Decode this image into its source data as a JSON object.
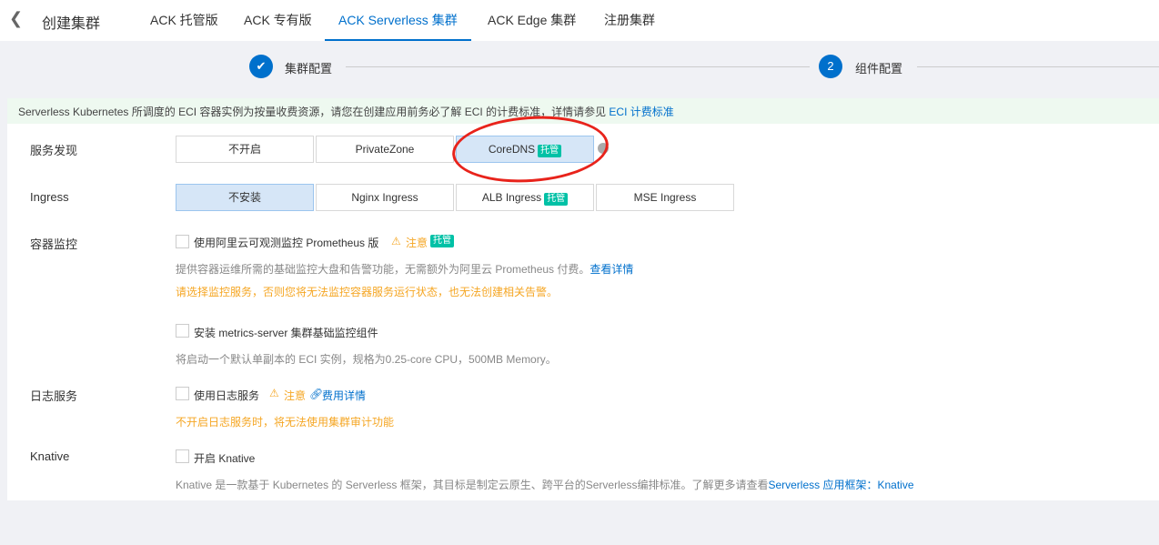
{
  "header": {
    "back_icon": "chevron-left-icon",
    "title": "创建集群",
    "tabs": [
      "ACK 托管版",
      "ACK 专有版",
      "ACK Serverless 集群",
      "ACK Edge 集群",
      "注册集群"
    ],
    "active_tab": 2
  },
  "steps": [
    {
      "label": "集群配置",
      "icon": "check-icon",
      "mark": "✔"
    },
    {
      "label": "组件配置",
      "number": "2"
    }
  ],
  "notice": {
    "text": "Serverless Kubernetes 所调度的 ECI 容器实例为按量收费资源，请您在创建应用前务必了解 ECI 的计费标准，详情请参见 ",
    "link": "ECI 计费标准"
  },
  "service_discovery": {
    "label": "服务发现",
    "options": [
      "不开启",
      "PrivateZone",
      "CoreDNS"
    ],
    "selected": "CoreDNS",
    "tag": "托管"
  },
  "ingress": {
    "label": "Ingress",
    "options": [
      "不安装",
      "Nginx Ingress",
      "ALB Ingress",
      "MSE Ingress"
    ],
    "selected": "不安装",
    "tag": "托管"
  },
  "monitoring": {
    "label": "容器监控",
    "prometheus": "使用阿里云可观测监控 Prometheus 版",
    "note": "注意",
    "tag": "托管",
    "desc": "提供容器运维所需的基础监控大盘和告警功能，无需额外为阿里云 Prometheus 付费。",
    "desc_link": "查看详情",
    "warning": "请选择监控服务，否则您将无法监控容器服务运行状态，也无法创建相关告警。",
    "metrics": "安装 metrics-server 集群基础监控组件",
    "metrics_desc": "将启动一个默认单副本的 ECI 实例，规格为0.25-core CPU，500MB Memory。"
  },
  "logging": {
    "label": "日志服务",
    "checkbox": "使用日志服务",
    "note": "注意",
    "link": "费用详情",
    "warning": "不开启日志服务时，将无法使用集群审计功能"
  },
  "knative": {
    "label": "Knative",
    "checkbox": "开启 Knative",
    "desc": "Knative 是一款基于 Kubernetes 的 Serverless 框架，其目标是制定云原生、跨平台的Serverless编排标准。了解更多请查看",
    "link": "Serverless 应用框架：Knative"
  }
}
